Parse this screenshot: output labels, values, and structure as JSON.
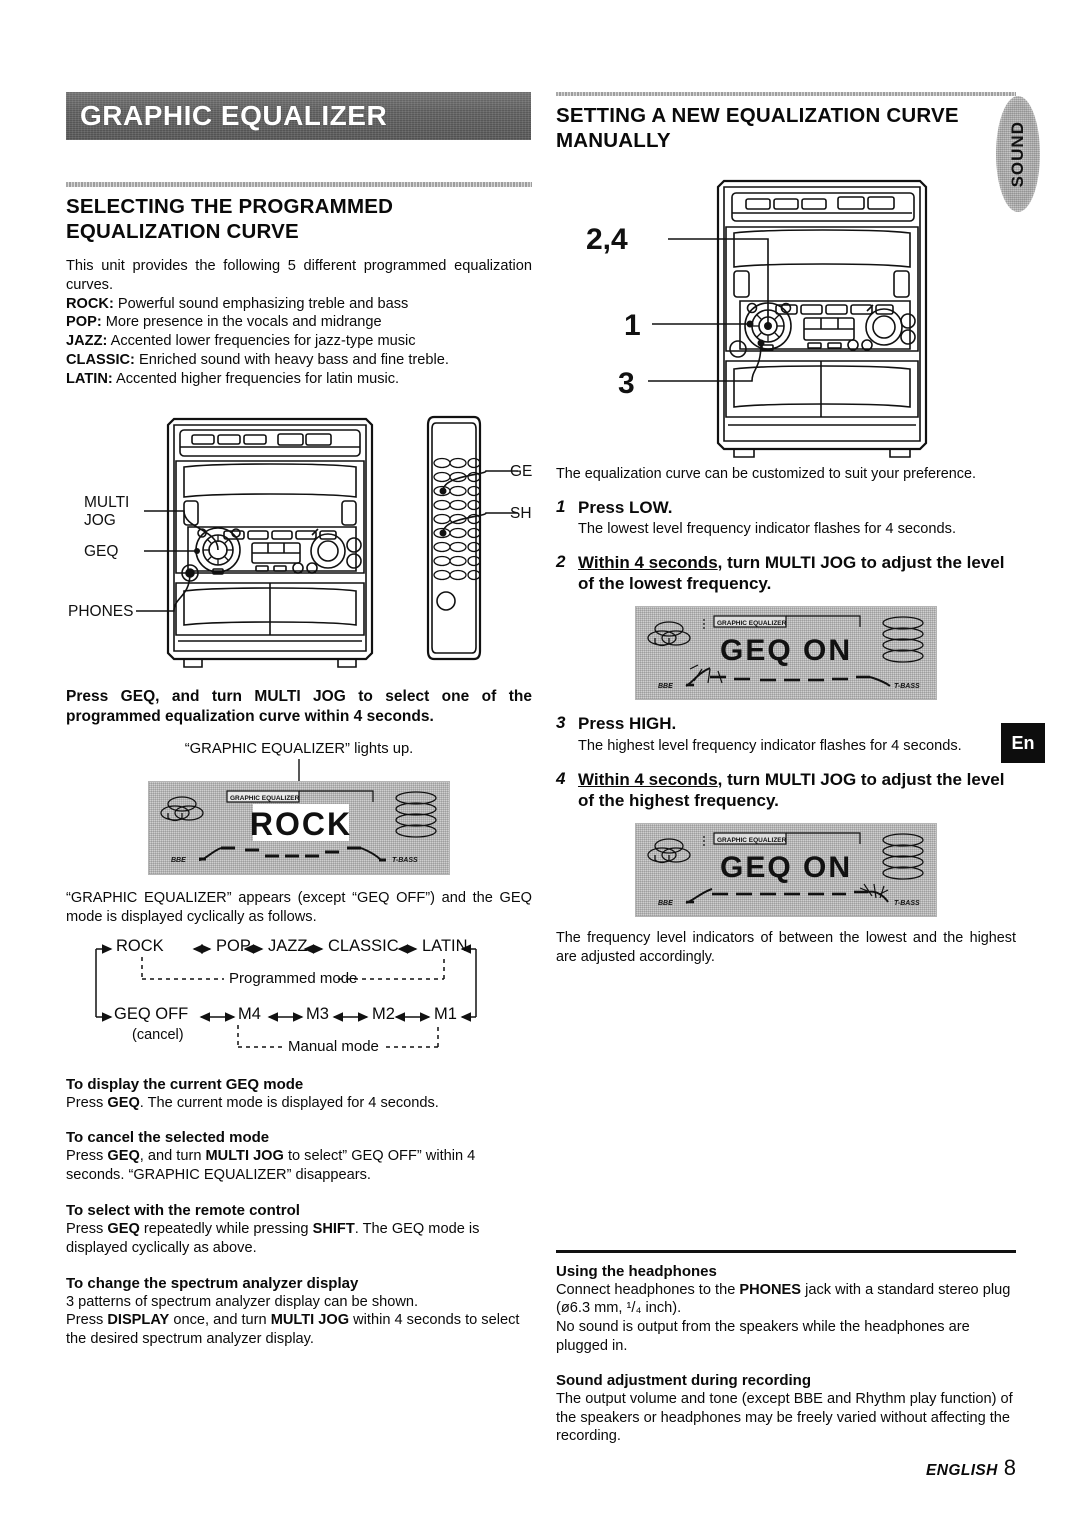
{
  "page": {
    "footer_label": "ENGLISH",
    "page_number": "8",
    "side_tab": "SOUND",
    "lang_badge": "En"
  },
  "left": {
    "banner_title": "GRAPHIC EQUALIZER",
    "section_heading": "SELECTING THE PROGRAMMED EQUALIZATION CURVE",
    "intro": "This unit provides the following 5 different programmed equalization curves.",
    "curves": [
      {
        "name": "ROCK:",
        "desc": " Powerful sound emphasizing treble and bass"
      },
      {
        "name": "POP:",
        "desc": " More presence in the vocals and midrange"
      },
      {
        "name": "JAZZ:",
        "desc": " Accented lower frequencies for jazz-type music"
      },
      {
        "name": "CLASSIC:",
        "desc": " Enriched sound with heavy bass and fine treble."
      },
      {
        "name": "LATIN:",
        "desc": " Accented higher frequencies for latin music."
      }
    ],
    "diagram_labels": {
      "multi": "MULTI",
      "jog": "JOG",
      "geq_unit": "GEQ",
      "phones": "PHONES",
      "geq_remote": "GEQ",
      "shift_remote": "SHIFT"
    },
    "instruction_bold": "Press GEQ, and turn MULTI JOG to select one of the programmed equalization curve within 4 seconds.",
    "lcd_caption": "“GRAPHIC EQUALIZER” lights up.",
    "lcd": {
      "indicator": "GRAPHIC EQUALIZER",
      "main_text": "ROCK",
      "left_mark": "BBE",
      "right_mark": "T-BASS"
    },
    "after_lcd": "“GRAPHIC EQUALIZER”  appears (except “GEQ OFF”) and the GEQ mode is displayed cyclically as follows.",
    "cycle": {
      "row1": [
        "ROCK",
        "POP",
        "JAZZ",
        "CLASSIC",
        "LATIN"
      ],
      "row2": [
        "GEQ OFF",
        "M4",
        "M3",
        "M2",
        "M1"
      ],
      "label_programmed": "Programmed mode",
      "label_manual": "Manual mode",
      "cancel_note": "(cancel)"
    },
    "subsections": [
      {
        "title": "To display the current GEQ mode",
        "lines": [
          [
            {
              "t": "Press ",
              "b": false
            },
            {
              "t": "GEQ",
              "b": true
            },
            {
              "t": ". The current mode is displayed for 4 seconds.",
              "b": false
            }
          ]
        ]
      },
      {
        "title": "To cancel the selected mode",
        "lines": [
          [
            {
              "t": "Press ",
              "b": false
            },
            {
              "t": "GEQ",
              "b": true
            },
            {
              "t": ", and turn ",
              "b": false
            },
            {
              "t": "MULTI JOG",
              "b": true
            },
            {
              "t": " to select” GEQ OFF” within 4 seconds.  “GRAPHIC EQUALIZER” disappears.",
              "b": false
            }
          ]
        ]
      },
      {
        "title": "To select with the remote control",
        "lines": [
          [
            {
              "t": "Press ",
              "b": false
            },
            {
              "t": "GEQ",
              "b": true
            },
            {
              "t": " repeatedly while pressing ",
              "b": false
            },
            {
              "t": "SHIFT",
              "b": true
            },
            {
              "t": ". The GEQ mode is displayed cyclically as above.",
              "b": false
            }
          ]
        ]
      },
      {
        "title": "To change the spectrum analyzer display",
        "lines": [
          [
            {
              "t": "3 patterns of spectrum analyzer display can be shown.",
              "b": false
            }
          ],
          [
            {
              "t": "Press ",
              "b": false
            },
            {
              "t": "DISPLAY",
              "b": true
            },
            {
              "t": " once, and turn ",
              "b": false
            },
            {
              "t": "MULTI JOG",
              "b": true
            },
            {
              "t": " within 4 seconds to select the desired spectrum analyzer display.",
              "b": false
            }
          ]
        ]
      }
    ]
  },
  "right": {
    "section_heading": "SETTING  A NEW EQUALIZATION CURVE MANUALLY",
    "diagram_labels": {
      "step24": "2,4",
      "step1": "1",
      "step3": "3"
    },
    "intro": "The equalization curve can be customized to suit your preference.",
    "steps": [
      {
        "num": "1",
        "heading": "Press LOW.",
        "body": "The lowest level frequency indicator flashes for 4 seconds."
      },
      {
        "num": "2",
        "heading_underline": "Within 4 seconds",
        "heading_rest": ", turn MULTI JOG to adjust the level of the lowest frequency.",
        "body": ""
      },
      {
        "num": "3",
        "heading": "Press HIGH.",
        "body": "The highest level frequency indicator flashes for 4 seconds."
      },
      {
        "num": "4",
        "heading_underline": "Within 4 seconds",
        "heading_rest": ", turn MULTI JOG to adjust the level of the highest frequency.",
        "body": ""
      }
    ],
    "lcd1": {
      "indicator": "GRAPHIC EQUALIZER",
      "main_text": "GEQ ON",
      "left_mark": "BBE",
      "right_mark": "T-BASS"
    },
    "lcd2": {
      "indicator": "GRAPHIC EQUALIZER",
      "main_text": "GEQ ON",
      "left_mark": "BBE",
      "right_mark": "T-BASS"
    },
    "after_lcd2": "The frequency level indicators of between the lowest and the highest are adjusted accordingly.",
    "notes": [
      {
        "title": "Using the headphones",
        "lines": [
          [
            {
              "t": "Connect headphones to the ",
              "b": false
            },
            {
              "t": "PHONES",
              "b": true
            },
            {
              "t": " jack with a standard stereo plug (ø6.3 mm, ¹/₄ inch).",
              "b": false
            }
          ],
          [
            {
              "t": "No sound is output from the speakers while the headphones are plugged in.",
              "b": false
            }
          ]
        ]
      },
      {
        "title": "Sound adjustment during recording",
        "lines": [
          [
            {
              "t": "The output volume and tone (except BBE and Rhythm play function) of the speakers or headphones may be freely varied without affecting the recording.",
              "b": false
            }
          ]
        ]
      }
    ]
  }
}
